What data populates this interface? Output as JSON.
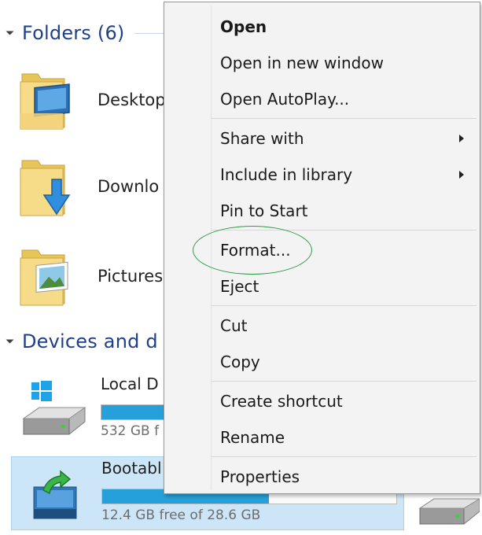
{
  "sections": {
    "folders_header": "Folders (6)",
    "devices_header": "Devices and d"
  },
  "folders": [
    {
      "label": "Desktop",
      "icon": "desktop-folder-icon"
    },
    {
      "label": "Downlo",
      "icon": "downloads-folder-icon"
    },
    {
      "label": "Pictures",
      "icon": "pictures-folder-icon"
    }
  ],
  "drives": {
    "local": {
      "name": "Local D",
      "free_text": "532 GB f",
      "usage_fraction": 0.55,
      "icon": "windows-drive-icon"
    },
    "bootable": {
      "name": "Bootabl",
      "free_text": "12.4 GB free of 28.6 GB",
      "usage_fraction": 0.566,
      "icon": "usb-drive-icon",
      "selected": true
    }
  },
  "context_menu": {
    "items": [
      {
        "label": "Open",
        "bold": true
      },
      {
        "label": "Open in new window"
      },
      {
        "label": "Open AutoPlay..."
      },
      {
        "label": "Share with",
        "submenu": true
      },
      {
        "label": "Include in library",
        "submenu": true
      },
      {
        "label": "Pin to Start"
      },
      {
        "label": "Format...",
        "highlighted": true
      },
      {
        "label": "Eject"
      },
      {
        "label": "Cut"
      },
      {
        "label": "Copy"
      },
      {
        "label": "Create shortcut"
      },
      {
        "label": "Rename"
      },
      {
        "label": "Properties"
      }
    ]
  },
  "colors": {
    "header_blue": "#1e3f8a",
    "progress_blue": "#26a0da",
    "selection_bg": "#cde6f7",
    "menu_bg": "#f3f3f3",
    "annotation_green": "#2e9a48"
  }
}
